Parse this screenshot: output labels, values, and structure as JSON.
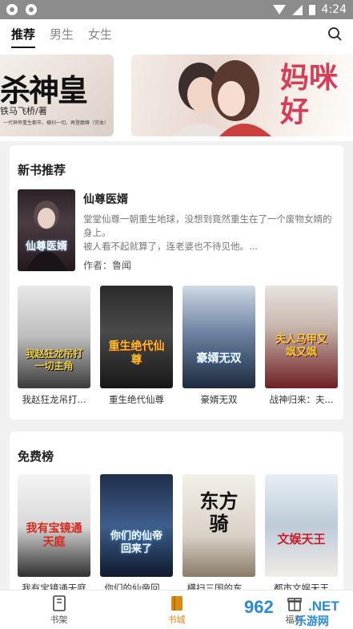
{
  "status_bar": {
    "time": "4:24"
  },
  "header": {
    "tabs": [
      {
        "label": "推荐",
        "active": true
      },
      {
        "label": "男生",
        "active": false
      },
      {
        "label": "女生",
        "active": false
      }
    ]
  },
  "banner": {
    "left": {
      "title": "杀神皇",
      "author": "铁马飞桥/著",
      "tagline": "一代神帝重生都市，横扫一切，再登巅峰（完本）"
    },
    "right": {
      "title": "妈咪好"
    }
  },
  "new_books": {
    "title": "新书推荐",
    "featured": {
      "name": "仙尊医婿",
      "cover_text": "仙尊医婿",
      "description": "堂堂仙尊一朝重生地球，没想到竟然重生在了一个废物女婿的身上。\n被人看不起就算了，连老婆也不待见他。...",
      "author": "作者：鲁闻"
    },
    "books": [
      {
        "title": "我赵狂龙吊打...",
        "cover_text": "我赵狂龙吊打一切主角"
      },
      {
        "title": "重生绝代仙尊",
        "cover_text": "重生绝代仙尊"
      },
      {
        "title": "豪婿无双",
        "cover_text": "豪婿无双"
      },
      {
        "title": "战神归来：夫...",
        "cover_text": "夫人马甲又飒又飒"
      }
    ]
  },
  "free_ranking": {
    "title": "免费榜",
    "books": [
      {
        "title": "我有宝镜通天庭",
        "cover_text": "我有宝镜通天庭"
      },
      {
        "title": "你们的仙帝回...",
        "cover_text": "你们的仙帝回来了"
      },
      {
        "title": "横扫三国的东...",
        "cover_text": "东方骑"
      },
      {
        "title": "都市文娱天王",
        "cover_text": "文娱天王"
      }
    ]
  },
  "bottom_nav": [
    {
      "label": "书架",
      "icon": "bookshelf-icon",
      "active": false
    },
    {
      "label": "书城",
      "icon": "bookstore-icon",
      "active": true
    },
    {
      "label": "福利",
      "icon": "gift-icon",
      "active": false
    }
  ],
  "watermark": {
    "number": "962",
    "net": ".NET",
    "cn": "乐游网"
  },
  "colors": {
    "accent": "#d98a12",
    "banner_pink": "#d63d56"
  }
}
